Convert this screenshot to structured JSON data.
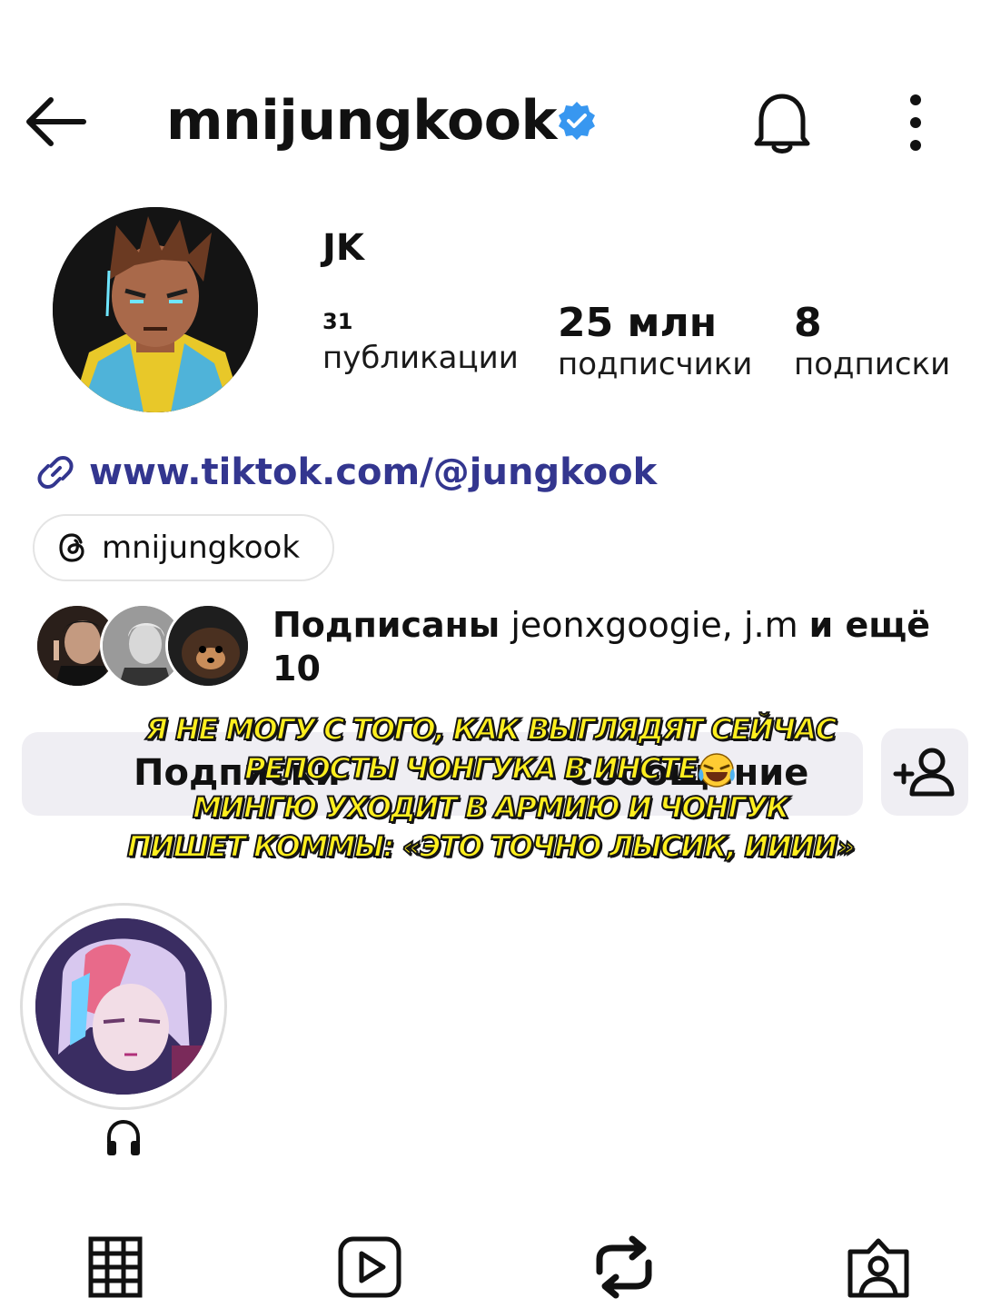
{
  "header": {
    "username": "mnijungkook",
    "verified": true,
    "back_icon": "back-arrow-icon",
    "bell_icon": "bell-icon",
    "more_icon": "more-vertical-icon"
  },
  "profile": {
    "display_name": "JK",
    "stats": {
      "posts": {
        "value": "31",
        "label": "публикации"
      },
      "followers": {
        "value": "25 млн",
        "label": "подписчики"
      },
      "following": {
        "value": "8",
        "label": "подписки"
      }
    },
    "link": "www.tiktok.com/@jungkook",
    "threads_handle": "mnijungkook"
  },
  "mutuals": {
    "prefix": "Подписаны",
    "names": " jeonxgoogie, j.m ",
    "suffix": "и ещё 10"
  },
  "actions": {
    "follow_label": "Подписки",
    "message_label": "Сообщение",
    "add_person_icon": "add-person-icon"
  },
  "caption": {
    "line1": "Я НЕ МОГУ С ТОГО, КАК ВЫГЛЯДЯТ СЕЙЧАС",
    "line2": "РЕПОСТЫ ЧОНГУКА В ИНСТЕ",
    "line3": "МИНГЮ УХОДИТ В АРМИЮ И ЧОНГУК",
    "line4": "ПИШЕТ КОММЫ: «ЭТО ТОЧНО ЛЫСИК, ИИИИ»",
    "emoji": "face-with-tears-of-joy"
  },
  "highlight": {
    "icon": "headphones-icon"
  },
  "tabs": [
    {
      "name": "grid",
      "icon": "grid-icon"
    },
    {
      "name": "reels",
      "icon": "reels-icon"
    },
    {
      "name": "reposts",
      "icon": "repost-icon",
      "active": true
    },
    {
      "name": "tagged",
      "icon": "tagged-person-icon"
    }
  ],
  "colors": {
    "verified": "#3897f0",
    "link": "#33368f",
    "button_bg": "#efeef3",
    "caption_fill": "#ffef1e",
    "caption_stroke": "#151515"
  }
}
